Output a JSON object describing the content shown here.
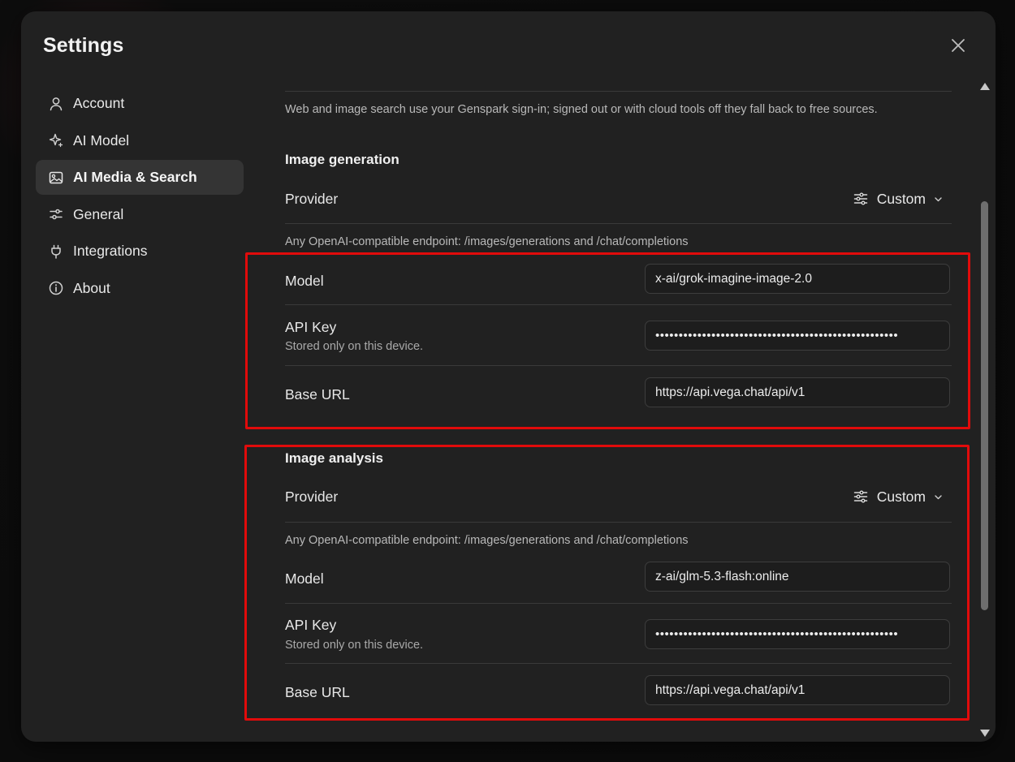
{
  "dialog": {
    "title": "Settings"
  },
  "sidebar": {
    "items": [
      {
        "label": "Account",
        "icon": "user-icon"
      },
      {
        "label": "AI Model",
        "icon": "sparkle-icon"
      },
      {
        "label": "AI Media & Search",
        "icon": "image-icon",
        "active": true
      },
      {
        "label": "General",
        "icon": "sliders-icon"
      },
      {
        "label": "Integrations",
        "icon": "plug-icon"
      },
      {
        "label": "About",
        "icon": "info-icon"
      }
    ]
  },
  "search_note": "Web and image search use your Genspark sign-in; signed out or with cloud tools off they fall back to free sources.",
  "image_generation": {
    "heading": "Image generation",
    "provider_label": "Provider",
    "provider_value": "Custom",
    "endpoint_note": "Any OpenAI-compatible endpoint: /images/generations and /chat/completions",
    "model_label": "Model",
    "model_value": "x-ai/grok-imagine-image-2.0",
    "api_key_label": "API Key",
    "api_key_note": "Stored only on this device.",
    "api_key_value": "••••••••••••••••••••••••••••••••••••••••••••••••••••",
    "base_url_label": "Base URL",
    "base_url_value": "https://api.vega.chat/api/v1"
  },
  "image_analysis": {
    "heading": "Image analysis",
    "provider_label": "Provider",
    "provider_value": "Custom",
    "endpoint_note": "Any OpenAI-compatible endpoint: /images/generations and /chat/completions",
    "model_label": "Model",
    "model_value": "z-ai/glm-5.3-flash:online",
    "api_key_label": "API Key",
    "api_key_note": "Stored only on this device.",
    "api_key_value": "••••••••••••••••••••••••••••••••••••••••••••••••••••",
    "base_url_label": "Base URL",
    "base_url_value": "https://api.vega.chat/api/v1"
  },
  "colors": {
    "accent_highlight": "#e10b0b",
    "dialog_bg": "#212121",
    "active_item_bg": "#343434"
  }
}
